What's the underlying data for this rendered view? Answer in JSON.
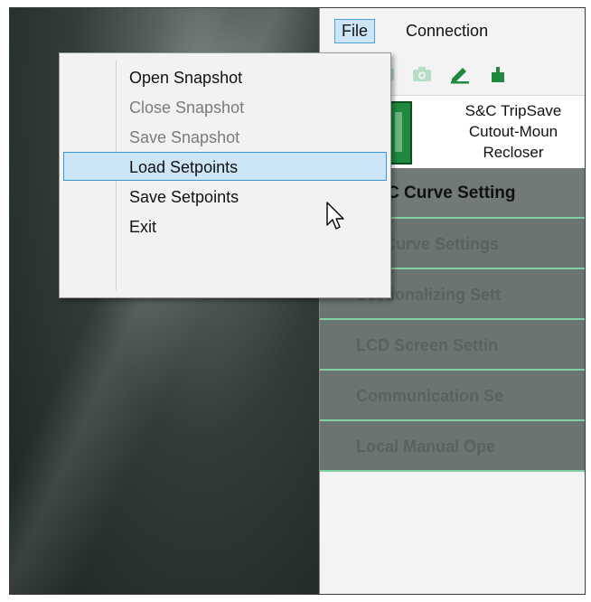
{
  "menubar": {
    "menus": [
      {
        "label": "File",
        "active": true
      },
      {
        "label": "Connection",
        "active": false
      }
    ]
  },
  "file_menu": {
    "items": [
      {
        "label": "Open Snapshot",
        "state": "enabled"
      },
      {
        "label": "Close Snapshot",
        "state": "disabled"
      },
      {
        "label": "Save Snapshot",
        "state": "disabled"
      },
      {
        "label": "Load Setpoints",
        "state": "hover"
      },
      {
        "label": "Save Setpoints",
        "state": "enabled"
      },
      {
        "label": "Exit",
        "state": "enabled"
      }
    ]
  },
  "toolbar": {
    "icons": [
      "disconnect-icon",
      "camera-icon",
      "edit-icon",
      "power-icon"
    ]
  },
  "device": {
    "name_lines": [
      "S&C TripSave",
      "Cutout-Moun",
      "Recloser"
    ]
  },
  "nav": {
    "items": [
      "C Curve Setting",
      "NR Curve Settings",
      "Sectionalizing Sett",
      "LCD Screen Settin",
      "Communication Se",
      "Local Manual Ope"
    ]
  },
  "colors": {
    "accent_green": "#1f8a3e",
    "menu_highlight": "#cde6f7",
    "menu_highlight_border": "#3c95d6",
    "nav_background": "#6a7470",
    "nav_divider": "#7fd1a5"
  }
}
